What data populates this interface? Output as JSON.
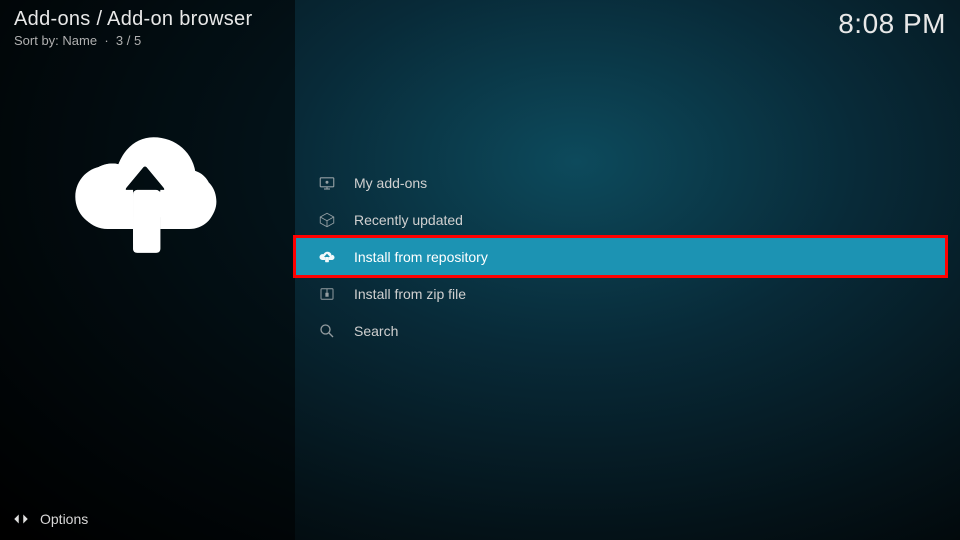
{
  "header": {
    "breadcrumb": "Add-ons / Add-on browser",
    "sort_label": "Sort by: Name",
    "position": "3 / 5",
    "clock": "8:08 PM"
  },
  "menu": {
    "items": [
      {
        "label": "My add-ons",
        "icon": "display-icon",
        "selected": false
      },
      {
        "label": "Recently updated",
        "icon": "box-icon",
        "selected": false
      },
      {
        "label": "Install from repository",
        "icon": "cloud-download-icon",
        "selected": true,
        "highlighted": true
      },
      {
        "label": "Install from zip file",
        "icon": "zip-icon",
        "selected": false
      },
      {
        "label": "Search",
        "icon": "search-icon",
        "selected": false
      }
    ]
  },
  "footer": {
    "options_label": "Options"
  }
}
